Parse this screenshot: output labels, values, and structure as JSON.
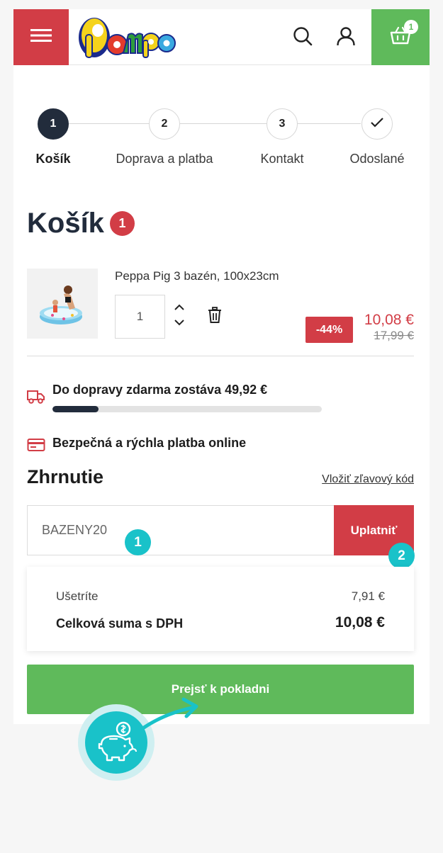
{
  "header": {
    "logo_text": "Pompo",
    "cart_count": "1"
  },
  "steps": [
    {
      "number": "1",
      "label": "Košík"
    },
    {
      "number": "2",
      "label": "Doprava a platba"
    },
    {
      "number": "3",
      "label": "Kontakt"
    },
    {
      "number": "",
      "label": "Odoslané"
    }
  ],
  "cart": {
    "title": "Košík",
    "count": "1"
  },
  "product": {
    "name": "Peppa Pig 3 bazén, 100x23cm",
    "quantity": "1",
    "discount": "-44%",
    "price": "10,08 €",
    "old_price": "17,99 €"
  },
  "shipping": {
    "text": "Do dopravy zdarma zostáva 49,92 €",
    "progress_fraction": 0.17
  },
  "payment": {
    "text": "Bezpečná a rýchla platba online"
  },
  "summary": {
    "title": "Zhrnutie",
    "coupon_link": "Vložiť zľavový kód",
    "coupon_value": "BAZENY20",
    "apply_label": "Uplatniť",
    "saved_label": "Ušetríte",
    "saved_value": "7,91 €",
    "total_label": "Celková suma s DPH",
    "total_value": "10,08 €",
    "checkout_label": "Prejsť k pokladni"
  },
  "markers": {
    "m1": "1",
    "m2": "2"
  },
  "colors": {
    "brand_red": "#d23d46",
    "brand_green": "#5fba5b",
    "dark_navy": "#222c3c",
    "accent_teal": "#19c2c9"
  }
}
